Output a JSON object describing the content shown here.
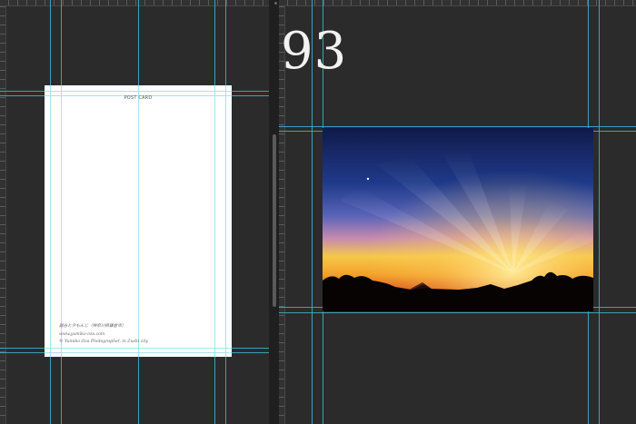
{
  "left_document": {
    "postcard": {
      "title": "POST CARD",
      "caption_line_1": "越谷と夕もんじ（神奈川県鎌倉市）",
      "caption_line_2": "www.yumiko-oza.com",
      "caption_line_3": "© Yumiko Oza Photographer, in Zushi city"
    }
  },
  "right_document": {
    "page_number": "93",
    "photo": {
      "subject": "sunset with crepuscular rays and crescent moon over silhouetted treeline and distant mountain"
    }
  },
  "colors": {
    "canvas_background": "#2b2b2b",
    "guide": "#3fb6c9",
    "page_number_text": "#f2f2f2",
    "postcard_paper": "#ffffff"
  },
  "icons": {
    "ruler": "ruler-tick-marks",
    "guides": "cyan-guide-lines"
  }
}
